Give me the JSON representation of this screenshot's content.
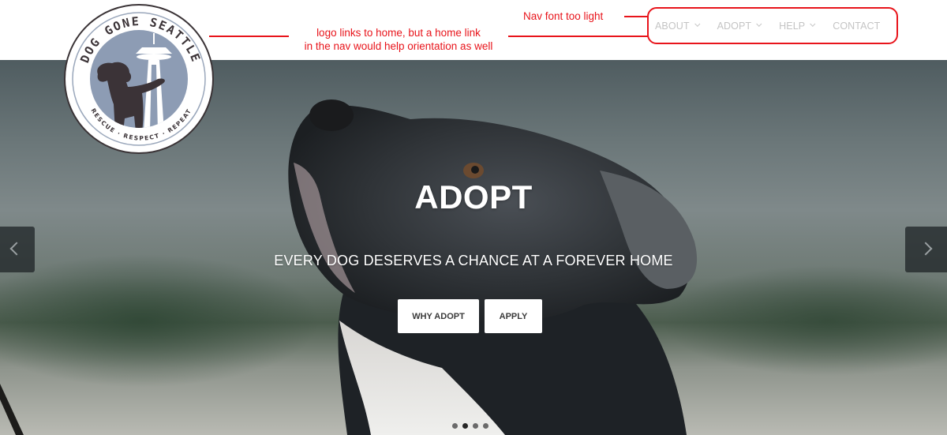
{
  "logo": {
    "top_text": "DOG GONE SEATTLE",
    "bottom_text": "RESCUE · RESPECT · REPEAT",
    "alt": "Dog Gone Seattle logo"
  },
  "nav": {
    "items": [
      {
        "label": "ABOUT",
        "has_dropdown": true
      },
      {
        "label": "ADOPT",
        "has_dropdown": true
      },
      {
        "label": "HELP",
        "has_dropdown": true
      },
      {
        "label": "CONTACT",
        "has_dropdown": false
      }
    ]
  },
  "annotations": {
    "logo_note_line1": "logo links to home, but a home link",
    "logo_note_line2": "in the nav would help orientation as well",
    "nav_note": "Nav font too light",
    "color": "#e8141b"
  },
  "hero": {
    "title": "ADOPT",
    "subtitle": "EVERY DOG DESERVES A CHANCE AT A FOREVER HOME",
    "buttons": [
      {
        "label": "WHY ADOPT"
      },
      {
        "label": "APPLY"
      }
    ],
    "carousel": {
      "slide_count": 4,
      "active_index": 1
    }
  }
}
